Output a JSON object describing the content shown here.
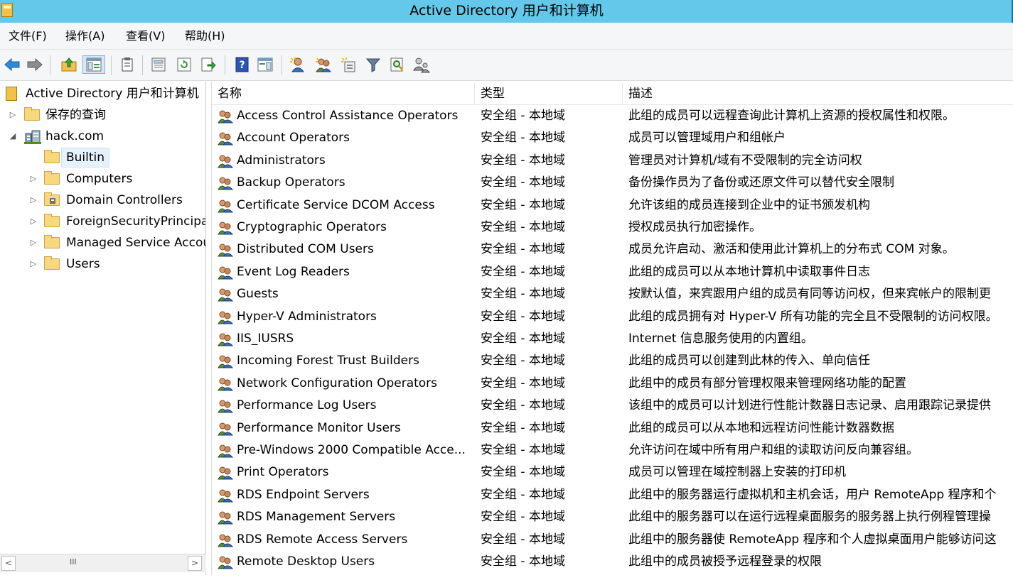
{
  "window": {
    "title": "Active Directory 用户和计算机"
  },
  "menu": [
    "文件(F)",
    "操作(A)",
    "查看(V)",
    "帮助(H)"
  ],
  "toolbar": [
    {
      "name": "back-icon"
    },
    {
      "name": "forward-icon"
    },
    {
      "name": "up-folder-icon"
    },
    {
      "name": "show-hide-tree-icon"
    },
    {
      "name": "copy-icon"
    },
    {
      "name": "properties-icon"
    },
    {
      "name": "refresh-icon"
    },
    {
      "name": "export-list-icon"
    },
    {
      "name": "help-icon"
    },
    {
      "name": "show-action-pane-icon"
    },
    {
      "name": "new-user-icon"
    },
    {
      "name": "new-group-icon"
    },
    {
      "name": "new-ou-icon"
    },
    {
      "name": "filter-icon"
    },
    {
      "name": "find-icon"
    },
    {
      "name": "add-to-group-icon"
    }
  ],
  "tree": {
    "root": "Active Directory 用户和计算机",
    "items": [
      {
        "label": "保存的查询",
        "expander": "collapsed"
      },
      {
        "label": "hack.com",
        "expander": "expanded"
      },
      {
        "label": "Builtin",
        "expander": "none",
        "selected": true
      },
      {
        "label": "Computers",
        "expander": "collapsed"
      },
      {
        "label": "Domain Controllers",
        "expander": "collapsed"
      },
      {
        "label": "ForeignSecurityPrincipals",
        "expander": "collapsed"
      },
      {
        "label": "Managed Service Accounts",
        "expander": "collapsed"
      },
      {
        "label": "Users",
        "expander": "collapsed"
      }
    ],
    "scroll_grip": "III"
  },
  "list": {
    "columns": [
      "名称",
      "类型",
      "描述"
    ],
    "rows": [
      {
        "name": "Access Control Assistance Operators",
        "type": "安全组 - 本地域",
        "desc": "此组的成员可以远程查询此计算机上资源的授权属性和权限。"
      },
      {
        "name": "Account Operators",
        "type": "安全组 - 本地域",
        "desc": "成员可以管理域用户和组帐户"
      },
      {
        "name": "Administrators",
        "type": "安全组 - 本地域",
        "desc": "管理员对计算机/域有不受限制的完全访问权"
      },
      {
        "name": "Backup Operators",
        "type": "安全组 - 本地域",
        "desc": "备份操作员为了备份或还原文件可以替代安全限制"
      },
      {
        "name": "Certificate Service DCOM Access",
        "type": "安全组 - 本地域",
        "desc": "允许该组的成员连接到企业中的证书颁发机构"
      },
      {
        "name": "Cryptographic Operators",
        "type": "安全组 - 本地域",
        "desc": "授权成员执行加密操作。"
      },
      {
        "name": "Distributed COM Users",
        "type": "安全组 - 本地域",
        "desc": "成员允许启动、激活和使用此计算机上的分布式 COM 对象。"
      },
      {
        "name": "Event Log Readers",
        "type": "安全组 - 本地域",
        "desc": "此组的成员可以从本地计算机中读取事件日志"
      },
      {
        "name": "Guests",
        "type": "安全组 - 本地域",
        "desc": "按默认值，来宾跟用户组的成员有同等访问权，但来宾帐户的限制更"
      },
      {
        "name": "Hyper-V Administrators",
        "type": "安全组 - 本地域",
        "desc": "此组的成员拥有对 Hyper-V 所有功能的完全且不受限制的访问权限。"
      },
      {
        "name": "IIS_IUSRS",
        "type": "安全组 - 本地域",
        "desc": "Internet 信息服务使用的内置组。"
      },
      {
        "name": "Incoming Forest Trust Builders",
        "type": "安全组 - 本地域",
        "desc": "此组的成员可以创建到此林的传入、单向信任"
      },
      {
        "name": "Network Configuration Operators",
        "type": "安全组 - 本地域",
        "desc": "此组中的成员有部分管理权限来管理网络功能的配置"
      },
      {
        "name": "Performance Log Users",
        "type": "安全组 - 本地域",
        "desc": "该组中的成员可以计划进行性能计数器日志记录、启用跟踪记录提供"
      },
      {
        "name": "Performance Monitor Users",
        "type": "安全组 - 本地域",
        "desc": "此组的成员可以从本地和远程访问性能计数器数据"
      },
      {
        "name": "Pre-Windows 2000 Compatible Acce...",
        "type": "安全组 - 本地域",
        "desc": "允许访问在域中所有用户和组的读取访问反向兼容组。"
      },
      {
        "name": "Print Operators",
        "type": "安全组 - 本地域",
        "desc": "成员可以管理在域控制器上安装的打印机"
      },
      {
        "name": "RDS Endpoint Servers",
        "type": "安全组 - 本地域",
        "desc": "此组中的服务器运行虚拟机和主机会话，用户 RemoteApp 程序和个"
      },
      {
        "name": "RDS Management Servers",
        "type": "安全组 - 本地域",
        "desc": "此组中的服务器可以在运行远程桌面服务的服务器上执行例程管理操"
      },
      {
        "name": "RDS Remote Access Servers",
        "type": "安全组 - 本地域",
        "desc": "此组中的服务器使 RemoteApp 程序和个人虚拟桌面用户能够访问这"
      },
      {
        "name": "Remote Desktop Users",
        "type": "安全组 - 本地域",
        "desc": "此组中的成员被授予远程登录的权限"
      }
    ]
  }
}
